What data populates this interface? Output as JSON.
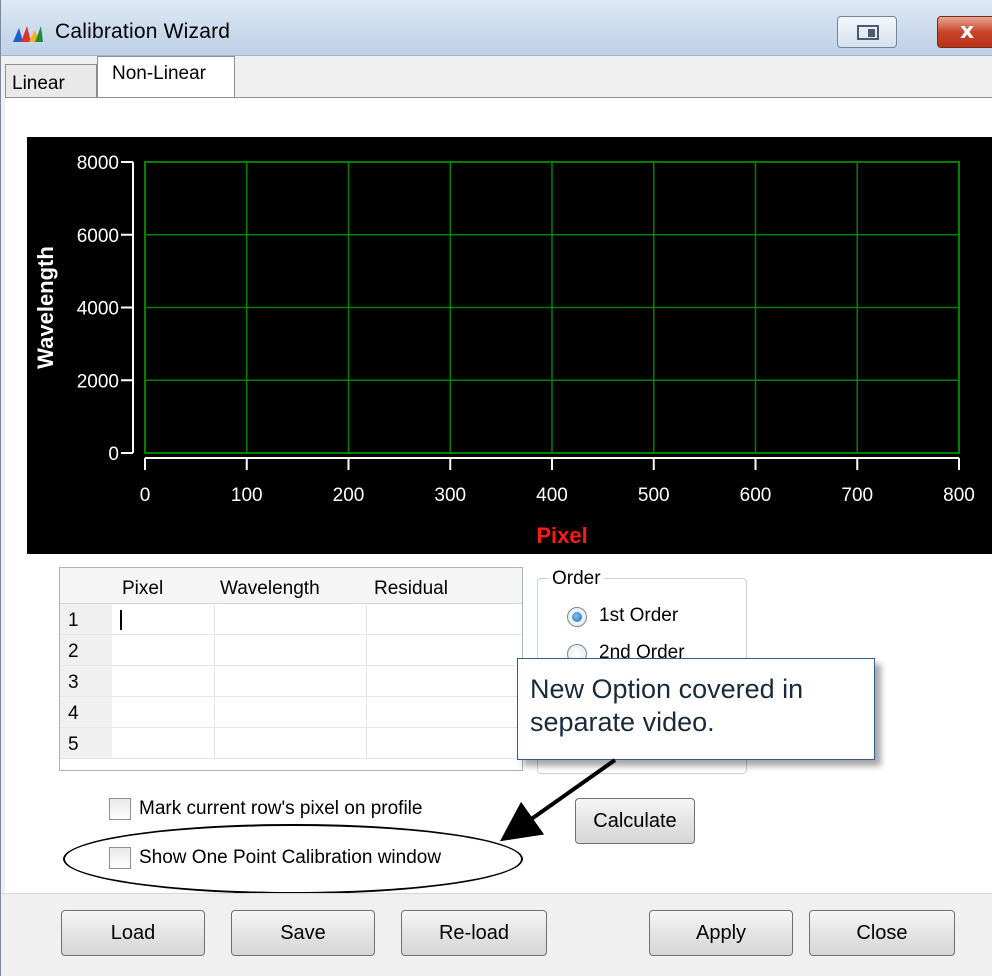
{
  "window": {
    "title": "Calibration Wizard",
    "close_glyph": "x"
  },
  "tabs": [
    {
      "label": "Linear",
      "active": false
    },
    {
      "label": "Non-Linear",
      "active": true
    }
  ],
  "chart_data": {
    "type": "line",
    "xlabel": "Pixel",
    "ylabel": "Wavelength",
    "xlim": [
      0,
      800
    ],
    "ylim": [
      0,
      8000
    ],
    "x_ticks": [
      0,
      100,
      200,
      300,
      400,
      500,
      600,
      700,
      800
    ],
    "y_ticks": [
      0,
      2000,
      4000,
      6000,
      8000
    ],
    "grid": true,
    "background": "#000000",
    "grid_color": "#008000",
    "xlabel_color": "#ff1a1a",
    "ylabel_color": "#ffffff",
    "series": []
  },
  "table": {
    "columns": [
      "",
      "Pixel",
      "Wavelength",
      "Residual"
    ],
    "rows": [
      {
        "num": "1",
        "pixel": "",
        "wavelength": "",
        "residual": ""
      },
      {
        "num": "2",
        "pixel": "",
        "wavelength": "",
        "residual": ""
      },
      {
        "num": "3",
        "pixel": "",
        "wavelength": "",
        "residual": ""
      },
      {
        "num": "4",
        "pixel": "",
        "wavelength": "",
        "residual": ""
      },
      {
        "num": "5",
        "pixel": "",
        "wavelength": "",
        "residual": ""
      }
    ]
  },
  "order": {
    "legend": "Order",
    "options": [
      {
        "label": "1st Order",
        "checked": true
      },
      {
        "label": "2nd Order",
        "checked": false
      }
    ]
  },
  "callout": {
    "text": "New Option covered in separate video."
  },
  "checkboxes": {
    "mark_current": {
      "label": "Mark current row's pixel on profile",
      "checked": false
    },
    "show_one_point": {
      "label": "Show One Point Calibration window",
      "checked": false
    }
  },
  "buttons": {
    "calculate": "Calculate",
    "load": "Load",
    "save": "Save",
    "reload": "Re-load",
    "apply": "Apply",
    "close": "Close"
  }
}
